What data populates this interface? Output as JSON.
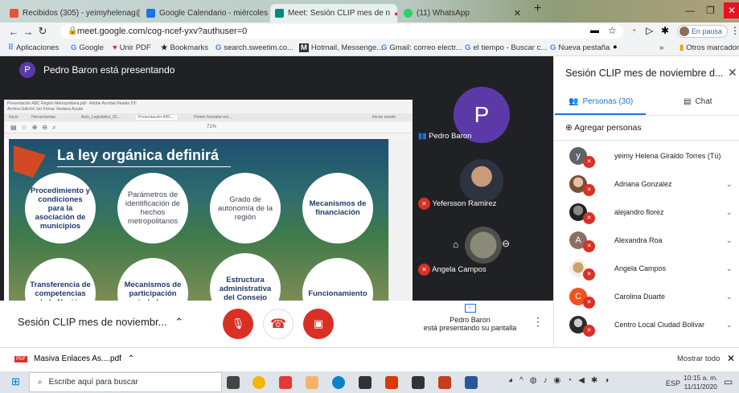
{
  "browser": {
    "tabs": [
      {
        "label": "Recibidos (305) - yeimyhelenag@...",
        "color": "#e5533a"
      },
      {
        "label": "Google Calendario - miércoles, 1...",
        "color": "#1a73e8"
      },
      {
        "label": "Meet: Sesión CLIP mes de n",
        "color": "#00897b"
      },
      {
        "label": "(11) WhatsApp",
        "color": "#25d366"
      }
    ],
    "url": "meet.google.com/cog-ncef-yxv?authuser=0",
    "pause_label": "En pausa",
    "bookmarks": [
      "Aplicaciones",
      "Google",
      "Unir PDF",
      "Bookmarks",
      "search.sweetim.co...",
      "Hotmail, Messenge...",
      "Gmail: correo electr...",
      "el tiempo - Buscar c...",
      "Nueva pestaña",
      "»",
      "Otros marcadores"
    ]
  },
  "meet": {
    "presenter_initial": "P",
    "presenting_banner": "Pedro Baron está presentando",
    "tiles": [
      {
        "name": "Pedro Baron",
        "initial": "P"
      },
      {
        "name": "Yefersson Ramirez"
      },
      {
        "name": "Angela Campos"
      }
    ],
    "meeting_title": "Sesión CLIP mes de noviembr...",
    "present_button": "Pedro Baron",
    "present_status": "está presentando su pantalla"
  },
  "shared_screen": {
    "window_title": "Presentación ABC Región Metropolitana.pdf - Adobe Acrobat Reader DC",
    "menu": "Archivo  Edición  Ver  Firmar  Ventana  Ayuda",
    "tab1": "Inicio",
    "tab2": "Herramientas",
    "tab3": "Acto_Legislativo_02...",
    "tab4": "Presentación ABC...",
    "tab5": "Primer borrador est...",
    "login": "Iniciar sesión",
    "zoom": "71%",
    "slide_title": "La ley orgánica definirá",
    "circles": [
      "Procedimiento y condiciones para la asociación de municipios",
      "Parámetros de identificación de hechos metropolitanos",
      "Grado de autonomía de la región",
      "Mecanismos de financiación",
      "Transferencia de competencias de la Nación",
      "Mecanismos de participación ciudadana",
      "Estructura administrativa del Consejo",
      "Funcionamiento"
    ]
  },
  "panel": {
    "title": "Sesión CLIP mes de noviembre d...",
    "people_tab": "Personas (30)",
    "chat_tab": "Chat",
    "add_people": "Agregar personas",
    "people": [
      {
        "name": "yeimy Helena Giraldo Torres (Tú)",
        "initial": "y",
        "color": "#5f6368"
      },
      {
        "name": "Adriana Gonzalez",
        "initial": "",
        "color": "#b07a5a"
      },
      {
        "name": "alejandro florez",
        "initial": "",
        "color": "#333333"
      },
      {
        "name": "Alexandra Roa",
        "initial": "A",
        "color": "#8d6e63"
      },
      {
        "name": "Angela Campos",
        "initial": "",
        "color": "#c9a46a"
      },
      {
        "name": "Carolina Duarte",
        "initial": "C",
        "color": "#f4511e"
      },
      {
        "name": "Centro Local Ciudad Bolivar",
        "initial": "",
        "color": "#2b2b2b"
      }
    ]
  },
  "download": {
    "file": "Masiva Enlaces As....pdf",
    "show_all": "Mostrar todo"
  },
  "taskbar": {
    "search": "Escribe aquí para buscar",
    "lang": "ESP",
    "time": "10:15 a. m.",
    "date": "11/11/2020"
  }
}
